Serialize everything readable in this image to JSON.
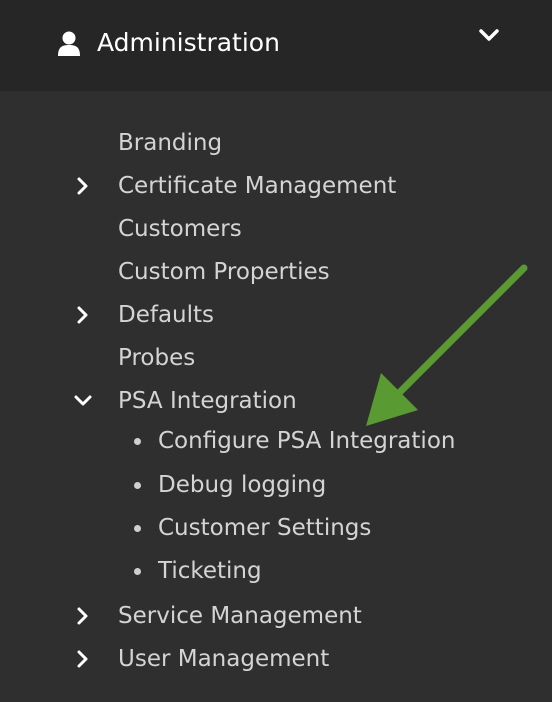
{
  "header": {
    "title": "Administration",
    "user_icon": "user-icon",
    "toggle_icon": "chevron-down-icon"
  },
  "menu": {
    "items": [
      {
        "label": "Branding",
        "expander": "none"
      },
      {
        "label": "Certificate Management",
        "expander": "collapsed"
      },
      {
        "label": "Customers",
        "expander": "none"
      },
      {
        "label": "Custom Properties",
        "expander": "none"
      },
      {
        "label": "Defaults",
        "expander": "collapsed"
      },
      {
        "label": "Probes",
        "expander": "none"
      },
      {
        "label": "PSA Integration",
        "expander": "expanded"
      },
      {
        "label": "Service Management",
        "expander": "collapsed"
      },
      {
        "label": "User Management",
        "expander": "collapsed"
      }
    ],
    "psa_subitems": [
      {
        "label": "Configure PSA Integration"
      },
      {
        "label": "Debug logging"
      },
      {
        "label": "Customer Settings"
      },
      {
        "label": "Ticketing"
      }
    ]
  },
  "annotation": {
    "type": "arrow",
    "color": "#5a9a32",
    "points_to": "Configure PSA Integration"
  },
  "colors": {
    "panel_bg": "#2f2f2f",
    "header_bg": "#262626",
    "text": "#d4d4d4",
    "header_text": "#ffffff"
  }
}
